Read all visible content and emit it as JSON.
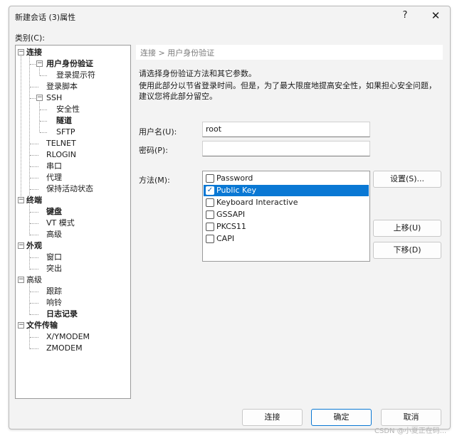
{
  "window": {
    "title": "新建会话 (3)属性",
    "help_label": "?",
    "close_label": "✕"
  },
  "category_label": "类别(C):",
  "tree": [
    {
      "label": "连接",
      "bold": true,
      "expanded": true
    },
    {
      "label": "用户身份验证",
      "bold": true,
      "expanded": true
    },
    {
      "label": "登录提示符",
      "bold": false
    },
    {
      "label": "登录脚本",
      "bold": false
    },
    {
      "label": "SSH",
      "bold": false,
      "expanded": true
    },
    {
      "label": "安全性",
      "bold": false
    },
    {
      "label": "隧道",
      "bold": true
    },
    {
      "label": "SFTP",
      "bold": false
    },
    {
      "label": "TELNET",
      "bold": false
    },
    {
      "label": "RLOGIN",
      "bold": false
    },
    {
      "label": "串口",
      "bold": false
    },
    {
      "label": "代理",
      "bold": false
    },
    {
      "label": "保持活动状态",
      "bold": false
    },
    {
      "label": "终端",
      "bold": true,
      "expanded": true
    },
    {
      "label": "键盘",
      "bold": true
    },
    {
      "label": "VT 模式",
      "bold": false
    },
    {
      "label": "高级",
      "bold": false
    },
    {
      "label": "外观",
      "bold": true,
      "expanded": true
    },
    {
      "label": "窗口",
      "bold": false
    },
    {
      "label": "突出",
      "bold": false
    },
    {
      "label": "高级",
      "bold": false,
      "expanded": true
    },
    {
      "label": "跟踪",
      "bold": false
    },
    {
      "label": "响铃",
      "bold": false
    },
    {
      "label": "日志记录",
      "bold": true
    },
    {
      "label": "文件传输",
      "bold": true,
      "expanded": true
    },
    {
      "label": "X/YMODEM",
      "bold": false
    },
    {
      "label": "ZMODEM",
      "bold": false
    }
  ],
  "breadcrumb": "连接 > 用户身份验证",
  "description_1": "请选择身份验证方法和其它参数。",
  "description_2": "使用此部分以节省登录时间。但是，为了最大限度地提高安全性，如果担心安全问题，建议您将此部分留空。",
  "form": {
    "username_label": "用户名(U):",
    "username_value": "root",
    "password_label": "密码(P):",
    "password_value": "",
    "method_label": "方法(M):"
  },
  "methods": [
    {
      "label": "Password",
      "checked": false,
      "selected": false
    },
    {
      "label": "Public Key",
      "checked": true,
      "selected": true
    },
    {
      "label": "Keyboard Interactive",
      "checked": false,
      "selected": false
    },
    {
      "label": "GSSAPI",
      "checked": false,
      "selected": false
    },
    {
      "label": "PKCS11",
      "checked": false,
      "selected": false
    },
    {
      "label": "CAPI",
      "checked": false,
      "selected": false
    }
  ],
  "side_buttons": {
    "settings": "设置(S)...",
    "move_up": "上移(U)",
    "move_down": "下移(D)"
  },
  "footer_buttons": {
    "connect": "连接",
    "ok": "确定",
    "cancel": "取消"
  },
  "watermark": "CSDN @小夏正在码..."
}
